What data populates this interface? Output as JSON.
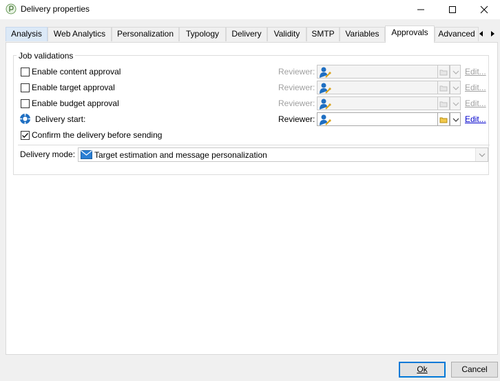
{
  "window": {
    "title": "Delivery properties",
    "app_icon": "adobe-campaign-icon",
    "controls": [
      "minimize-icon",
      "maximize-icon",
      "close-icon"
    ]
  },
  "tabs": [
    {
      "label": "Analysis"
    },
    {
      "label": "Web Analytics"
    },
    {
      "label": "Personalization"
    },
    {
      "label": "Typology"
    },
    {
      "label": "Delivery"
    },
    {
      "label": "Validity"
    },
    {
      "label": "SMTP"
    },
    {
      "label": "Variables"
    },
    {
      "label": "Approvals",
      "active": true
    },
    {
      "label": "Advanced"
    }
  ],
  "job_validations": {
    "legend": "Job validations",
    "rows": [
      {
        "label": "Enable content approval",
        "checked": false,
        "reviewer_label": "Reviewer:",
        "edit": "Edit...",
        "enabled": false
      },
      {
        "label": "Enable target approval",
        "checked": false,
        "reviewer_label": "Reviewer:",
        "edit": "Edit...",
        "enabled": false
      },
      {
        "label": "Enable budget approval",
        "checked": false,
        "reviewer_label": "Reviewer:",
        "edit": "Edit...",
        "enabled": false
      },
      {
        "label": "Delivery start:",
        "checked": null,
        "reviewer_label": "Reviewer:",
        "edit": "Edit...",
        "enabled": true
      }
    ],
    "confirm": {
      "label": "Confirm the delivery before sending",
      "checked": true
    },
    "delivery_mode": {
      "label": "Delivery mode:",
      "value": "Target estimation and message personalization"
    }
  },
  "buttons": {
    "ok": "Ok",
    "cancel": "Cancel"
  },
  "colors": {
    "link": "#0000cc",
    "disabled_text": "#a0a0a0",
    "focus_border": "#0078d7",
    "operator_icon": "#1f6fc2"
  }
}
